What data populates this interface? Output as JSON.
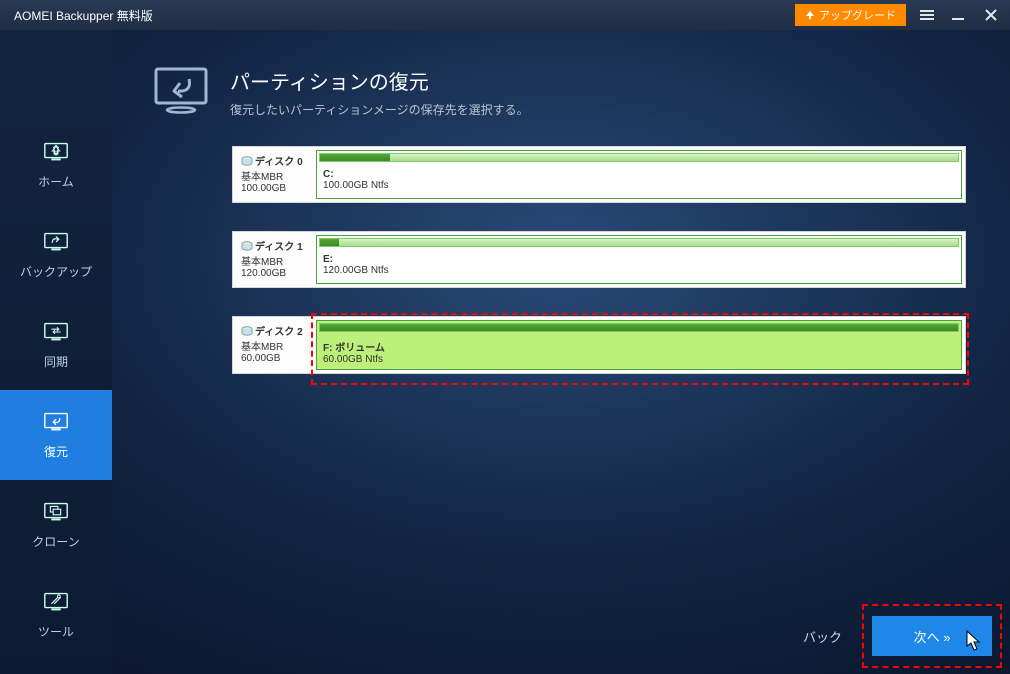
{
  "app_title": "AOMEI Backupper 無料版",
  "upgrade_label": "アップグレード",
  "sidebar": {
    "items": [
      {
        "label": "ホーム"
      },
      {
        "label": "バックアップ"
      },
      {
        "label": "同期"
      },
      {
        "label": "復元"
      },
      {
        "label": "クローン"
      },
      {
        "label": "ツール"
      }
    ]
  },
  "page": {
    "title": "パーティションの復元",
    "subtitle": "復元したいパーティションメージの保存先を選択する。"
  },
  "disks": [
    {
      "name": "ディスク 0",
      "type": "基本MBR",
      "size": "100.00GB",
      "partition": {
        "label": "C:",
        "detail": "100.00GB Ntfs",
        "used_pct": 11
      }
    },
    {
      "name": "ディスク 1",
      "type": "基本MBR",
      "size": "120.00GB",
      "partition": {
        "label": "E:",
        "detail": "120.00GB Ntfs",
        "used_pct": 3
      }
    },
    {
      "name": "ディスク 2",
      "type": "基本MBR",
      "size": "60.00GB",
      "partition": {
        "label": "F: ボリューム",
        "detail": "60.00GB Ntfs",
        "used_pct": 100
      }
    }
  ],
  "footer": {
    "back": "バック",
    "next": "次へ »"
  }
}
